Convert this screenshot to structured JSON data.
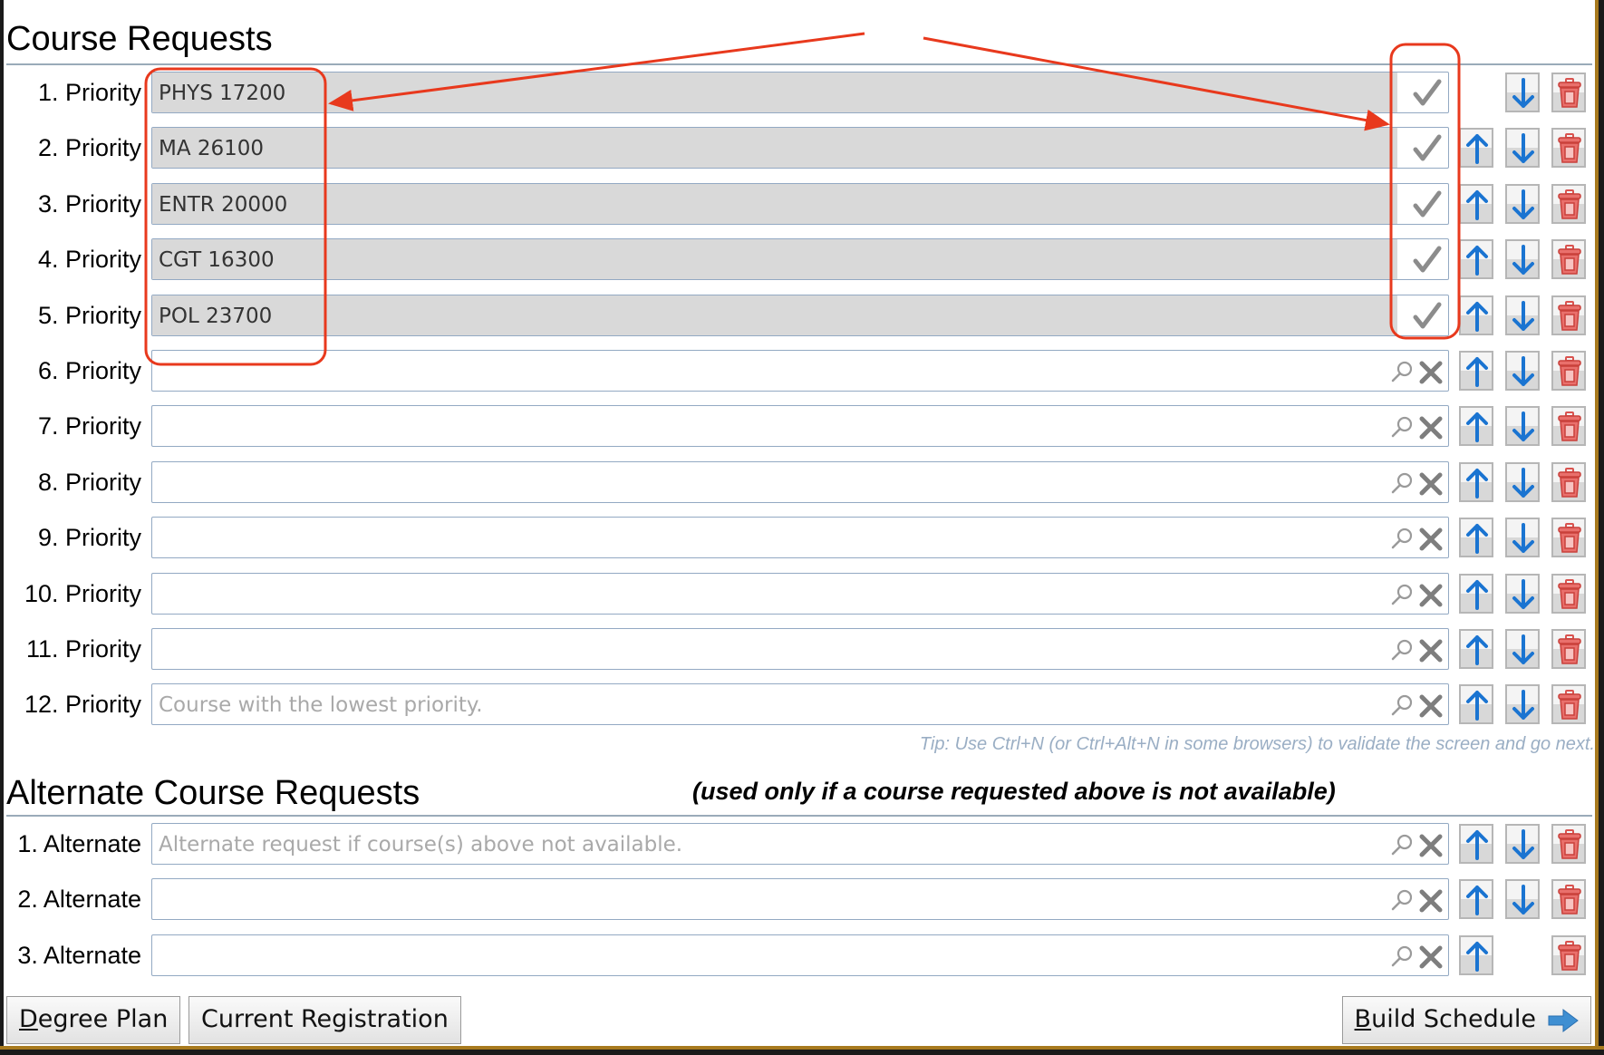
{
  "course_requests": {
    "title": "Course Requests",
    "rows": [
      {
        "label": "1. Priority",
        "value": "PHYS 17200",
        "placeholder": "",
        "status": "validated",
        "show_up": false,
        "show_down": true
      },
      {
        "label": "2. Priority",
        "value": "MA 26100",
        "placeholder": "",
        "status": "validated",
        "show_up": true,
        "show_down": true
      },
      {
        "label": "3. Priority",
        "value": "ENTR 20000",
        "placeholder": "",
        "status": "validated",
        "show_up": true,
        "show_down": true
      },
      {
        "label": "4. Priority",
        "value": "CGT 16300",
        "placeholder": "",
        "status": "validated",
        "show_up": true,
        "show_down": true
      },
      {
        "label": "5. Priority",
        "value": "POL 23700",
        "placeholder": "",
        "status": "validated",
        "show_up": true,
        "show_down": true
      },
      {
        "label": "6. Priority",
        "value": "",
        "placeholder": "",
        "status": "empty",
        "show_up": true,
        "show_down": true
      },
      {
        "label": "7. Priority",
        "value": "",
        "placeholder": "",
        "status": "empty",
        "show_up": true,
        "show_down": true
      },
      {
        "label": "8. Priority",
        "value": "",
        "placeholder": "",
        "status": "empty",
        "show_up": true,
        "show_down": true
      },
      {
        "label": "9. Priority",
        "value": "",
        "placeholder": "",
        "status": "empty",
        "show_up": true,
        "show_down": true
      },
      {
        "label": "10. Priority",
        "value": "",
        "placeholder": "",
        "status": "empty",
        "show_up": true,
        "show_down": true
      },
      {
        "label": "11. Priority",
        "value": "",
        "placeholder": "",
        "status": "empty",
        "show_up": true,
        "show_down": true
      },
      {
        "label": "12. Priority",
        "value": "",
        "placeholder": "Course with the lowest priority.",
        "status": "empty",
        "show_up": true,
        "show_down": true
      }
    ],
    "tip": "Tip: Use Ctrl+N (or Ctrl+Alt+N in some browsers) to validate the screen and go next."
  },
  "alternate_requests": {
    "title": "Alternate Course Requests",
    "note": "(used only if a course requested above is not available)",
    "rows": [
      {
        "label": "1. Alternate",
        "value": "",
        "placeholder": "Alternate request if course(s) above not available.",
        "status": "empty",
        "show_up": true,
        "show_down": true
      },
      {
        "label": "2. Alternate",
        "value": "",
        "placeholder": "",
        "status": "empty",
        "show_up": true,
        "show_down": true
      },
      {
        "label": "3. Alternate",
        "value": "",
        "placeholder": "",
        "status": "empty",
        "show_up": true,
        "show_down": false
      }
    ]
  },
  "footer": {
    "degree_plan": {
      "accesskey": "D",
      "rest": "egree Plan"
    },
    "current_registration": "Current Registration",
    "build_schedule": {
      "accesskey": "B",
      "rest": "uild Schedule"
    }
  },
  "icons": {
    "validated": "checkmark-icon",
    "search": "search-icon",
    "clear": "clear-x-icon",
    "move_up": "arrow-up-icon",
    "move_down": "arrow-down-icon",
    "delete": "trash-icon",
    "next": "arrow-right-icon"
  },
  "colors": {
    "arrow_blue": "#1a74d1",
    "trash_red": "#d9534f",
    "annotation_red": "#e8391d",
    "input_border": "#93a9c3",
    "validated_fill": "#d9d9d9",
    "tip_text": "#9aaec4"
  }
}
